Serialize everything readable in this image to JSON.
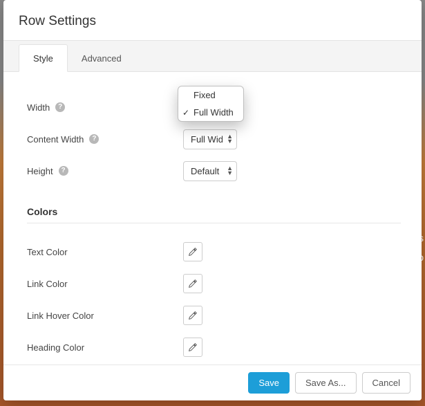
{
  "modal": {
    "title": "Row Settings"
  },
  "tabs": {
    "style": "Style",
    "advanced": "Advanced"
  },
  "fields": {
    "width": {
      "label": "Width"
    },
    "contentWidth": {
      "label": "Content Width",
      "value": "Full Width"
    },
    "height": {
      "label": "Height",
      "value": "Default"
    }
  },
  "widthDropdown": {
    "fixed": "Fixed",
    "fullWidth": "Full Width"
  },
  "sections": {
    "colors": "Colors"
  },
  "colorFields": {
    "text": "Text Color",
    "link": "Link Color",
    "linkHover": "Link Hover Color",
    "heading": "Heading Color"
  },
  "footer": {
    "save": "Save",
    "saveAs": "Save As...",
    "cancel": "Cancel"
  },
  "bgText": {
    "l1": "us",
    "l2": "so"
  }
}
